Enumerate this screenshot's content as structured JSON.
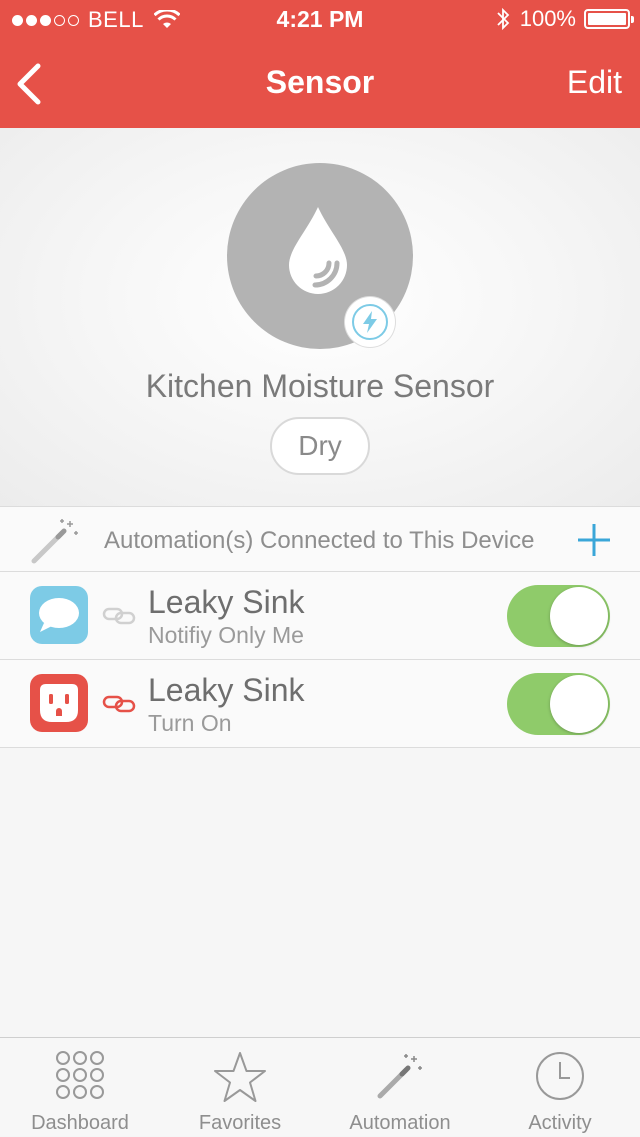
{
  "status_bar": {
    "carrier": "BELL",
    "time": "4:21 PM",
    "battery": "100%"
  },
  "nav": {
    "title": "Sensor",
    "edit_label": "Edit"
  },
  "device": {
    "name": "Kitchen Moisture Sensor",
    "state": "Dry"
  },
  "automations": {
    "header": "Automation(s) Connected to This Device",
    "items": [
      {
        "title": "Leaky Sink",
        "subtitle": "Notifiy Only Me",
        "icon": "chat-bubble-icon",
        "icon_color": "#7dcbe6",
        "enabled": true
      },
      {
        "title": "Leaky Sink",
        "subtitle": "Turn On",
        "icon": "outlet-icon",
        "icon_color": "#e65148",
        "enabled": true
      }
    ]
  },
  "tabbar": {
    "items": [
      {
        "label": "Dashboard",
        "icon": "grid-dots-icon"
      },
      {
        "label": "Favorites",
        "icon": "star-icon"
      },
      {
        "label": "Automation",
        "icon": "magic-wand-icon"
      },
      {
        "label": "Activity",
        "icon": "clock-icon"
      }
    ]
  },
  "colors": {
    "header": "#e65148",
    "toggle_on": "#8fcb6a",
    "accent_blue": "#3aa6d8"
  }
}
